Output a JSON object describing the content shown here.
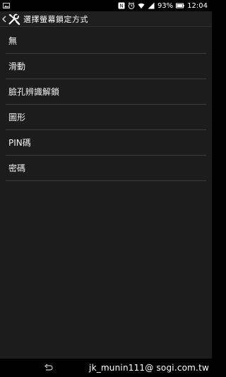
{
  "status_bar": {
    "left_icons": [
      "image-icon"
    ],
    "right_icons": [
      "nfc-icon",
      "alarm-icon",
      "wifi-icon",
      "signal-icon",
      "battery-icon"
    ],
    "battery_percent": "93%",
    "time": "12:04"
  },
  "action_bar": {
    "title": "選擇螢幕鎖定方式",
    "icon": "tools-icon"
  },
  "list": {
    "items": [
      {
        "label": "無"
      },
      {
        "label": "滑動"
      },
      {
        "label": "臉孔辨識解鎖"
      },
      {
        "label": "圖形"
      },
      {
        "label": "PIN碼"
      },
      {
        "label": "密碼"
      }
    ]
  },
  "nav_bar": {
    "watermark": "jk_munin111@ sogi.com.tw"
  },
  "colors": {
    "background": "#1c1c1c",
    "divider": "#3a3a3a",
    "text": "#f2f2f2",
    "nfc_red": "#d32f2f"
  }
}
